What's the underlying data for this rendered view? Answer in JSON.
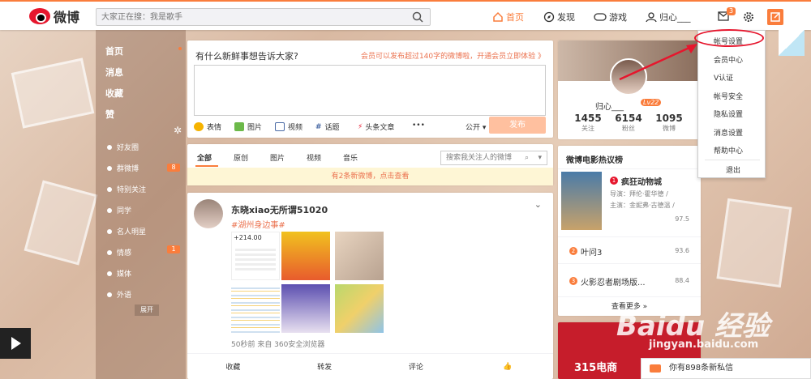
{
  "topbar": {
    "logo_text": "微博",
    "search_placeholder": "大家正在搜：我是歌手",
    "nav": {
      "home": "首页",
      "discover": "发现",
      "game": "游戏",
      "user": "归心___"
    },
    "message_count": "3"
  },
  "sidebar": {
    "main": [
      "首页",
      "消息",
      "收藏",
      "赞"
    ],
    "groups": [
      {
        "label": "好友圈",
        "badge": ""
      },
      {
        "label": "群微博",
        "badge": "8"
      },
      {
        "label": "特别关注",
        "badge": ""
      },
      {
        "label": "同学",
        "badge": ""
      },
      {
        "label": "名人明星",
        "badge": ""
      },
      {
        "label": "情感",
        "badge": "1"
      },
      {
        "label": "媒体",
        "badge": ""
      },
      {
        "label": "外语",
        "badge": ""
      }
    ],
    "expand": "展开"
  },
  "compose": {
    "title": "有什么新鲜事想告诉大家?",
    "hint": "会员可以发布超过140字的微博啦，开通会员立即体验 》",
    "tools": [
      "表情",
      "图片",
      "视频",
      "话题",
      "头条文章",
      "•••"
    ],
    "visibility": "公开",
    "publish": "发布"
  },
  "feed": {
    "tabs": [
      "全部",
      "原创",
      "图片",
      "视频",
      "音乐"
    ],
    "search_placeholder": "搜索我关注人的微博",
    "new_notice": "有2条新微博，点击查看"
  },
  "post": {
    "author": "东晓xiao无所谓51020",
    "topic": "#湖州身边事#",
    "amount": "+214.00",
    "meta": "50秒前 来自 360安全浏览器",
    "actions": [
      "收藏",
      "转发",
      "评论",
      "👍"
    ]
  },
  "profile": {
    "name": "归心___",
    "level": "Lv22",
    "stats": [
      {
        "num": "1455",
        "label": "关注"
      },
      {
        "num": "6154",
        "label": "粉丝"
      },
      {
        "num": "1095",
        "label": "微博"
      }
    ]
  },
  "movies": {
    "title": "微博电影热议榜",
    "items": [
      {
        "rank": "1",
        "name": "疯狂动物城",
        "info1": "导演：拜伦·霍华德 /",
        "info2": "主演：金妮弗·古德温 /",
        "score": "97.5"
      },
      {
        "rank": "2",
        "name": "叶问3",
        "score": "93.6"
      },
      {
        "rank": "3",
        "name": "火影忍者剧场版...",
        "score": "88.4"
      }
    ],
    "more": "查看更多 »"
  },
  "ad": {
    "text": "315电商"
  },
  "dropdown": {
    "items": [
      "帐号设置",
      "会员中心",
      "V认证",
      "帐号安全",
      "隐私设置",
      "消息设置",
      "帮助中心",
      "退出"
    ]
  },
  "chat": {
    "text": "你有898条新私信"
  },
  "watermark": {
    "brand": "Baidu 经验",
    "url": "jingyan.baidu.com"
  },
  "colors": {
    "accent": "#fa7d3c",
    "brand_red": "#e6162d",
    "link": "#eb7350"
  }
}
